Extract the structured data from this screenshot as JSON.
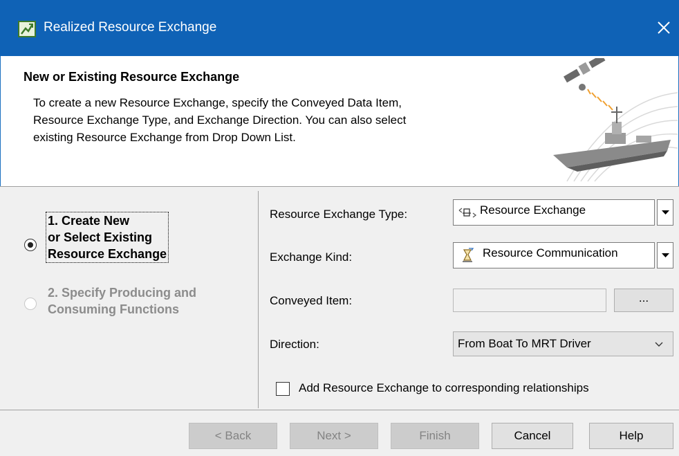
{
  "window": {
    "title": "Realized Resource Exchange",
    "close_label": "×"
  },
  "header": {
    "title": "New or Existing Resource Exchange",
    "description_lines": [
      "To create a new Resource Exchange, specify the Conveyed Data Item,",
      "Resource Exchange Type, and Exchange Direction. You can also select",
      "existing Resource Exchange from Drop Down List."
    ]
  },
  "steps": [
    {
      "lines": [
        "1. Create New",
        "or Select Existing",
        "Resource Exchange"
      ],
      "selected": true,
      "enabled": true
    },
    {
      "lines": [
        "2. Specify Producing and",
        "Consuming Functions"
      ],
      "selected": false,
      "enabled": false
    }
  ],
  "form": {
    "resource_exchange_type": {
      "label": "Resource Exchange Type:",
      "value": "Resource Exchange",
      "icon": "resource-exchange-icon"
    },
    "exchange_kind": {
      "label": "Exchange Kind:",
      "value": "Resource Communication",
      "icon": "resource-communication-icon"
    },
    "conveyed_item": {
      "label": "Conveyed Item:",
      "value": "",
      "browse_label": "..."
    },
    "direction": {
      "label": "Direction:",
      "value": "From Boat To MRT Driver"
    },
    "add_to_relationships": {
      "label": "Add Resource Exchange to corresponding relationships",
      "checked": false
    }
  },
  "buttons": {
    "back": {
      "label": "< Back",
      "enabled": false
    },
    "next": {
      "label": "Next >",
      "enabled": false
    },
    "finish": {
      "label": "Finish",
      "enabled": false
    },
    "cancel": {
      "label": "Cancel",
      "enabled": true
    },
    "help": {
      "label": "Help",
      "enabled": true
    }
  },
  "colors": {
    "title_bar": "#0f62b6",
    "title_text": "#ffffff",
    "dialog_bg": "#f0f0f0",
    "disabled_text": "#8c8c8c"
  }
}
